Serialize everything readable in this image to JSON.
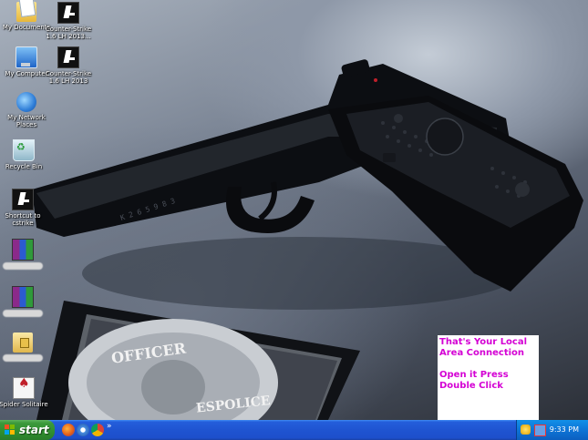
{
  "desktop_icons": [
    {
      "label": "My Documents",
      "icon": "my-documents-icon"
    },
    {
      "label": "Counter-Strike 1.6 LH 2013...",
      "icon": "counter-strike-icon"
    },
    {
      "label": "My Computer",
      "icon": "my-computer-icon"
    },
    {
      "label": "Counter-Strike 1.6 LH 2013",
      "icon": "counter-strike-icon"
    },
    {
      "label": "My Network Places",
      "icon": "network-places-icon"
    },
    {
      "label": "Recycle Bin",
      "icon": "recycle-bin-icon"
    },
    {
      "label": "Shortcut to cstrike",
      "icon": "cs-shortcut-icon"
    },
    {
      "label": "",
      "icon": "winrar-archive-icon"
    },
    {
      "label": "",
      "icon": "winrar-archive-icon"
    },
    {
      "label": "",
      "icon": "locked-folder-icon"
    },
    {
      "label": "Spider Solitaire",
      "icon": "spider-solitaire-icon"
    }
  ],
  "note": {
    "line1": "That's Your Local",
    "line2": "Area Connection",
    "line3": "Open it Press",
    "line4": "Double Click",
    "text_color": "#d400d4"
  },
  "badge_text": {
    "top": "OFFICER",
    "bottom": "ESPOLICE"
  },
  "taskbar": {
    "start_label": "start",
    "quick_launch": [
      "firefox-icon",
      "media-player-icon",
      "chrome-icon"
    ],
    "overflow": "»",
    "clock": "9:33 PM",
    "tray_icons": [
      "security-shield-icon",
      "network-connection-icon"
    ]
  },
  "colors": {
    "taskbar": "#245edb",
    "start_button": "#3c9a3c",
    "tray": "#0e74d6"
  }
}
